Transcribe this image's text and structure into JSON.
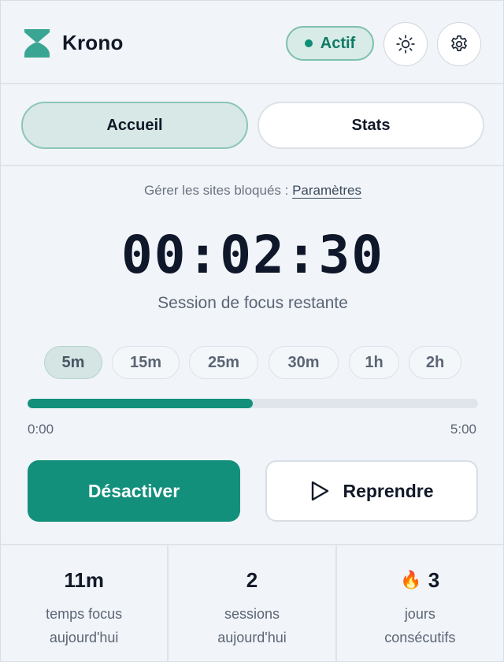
{
  "header": {
    "title": "Krono",
    "status": "Actif",
    "logo_icon": "hourglass-icon",
    "theme_icon": "sun-icon",
    "settings_icon": "gear-icon"
  },
  "tabs": [
    {
      "label": "Accueil",
      "active": true
    },
    {
      "label": "Stats",
      "active": false
    }
  ],
  "manage": {
    "text": "Gérer les sites bloqués : ",
    "link": "Paramètres"
  },
  "timer": {
    "value": "00:02:30",
    "label": "Session de focus restante"
  },
  "presets": [
    {
      "label": "5m",
      "active": true
    },
    {
      "label": "15m",
      "active": false
    },
    {
      "label": "25m",
      "active": false
    },
    {
      "label": "30m",
      "active": false
    },
    {
      "label": "1h",
      "active": false
    },
    {
      "label": "2h",
      "active": false
    }
  ],
  "progress": {
    "fraction": 0.5,
    "start": "0:00",
    "end": "5:00"
  },
  "actions": {
    "deactivate": "Désactiver",
    "resume": "Reprendre",
    "resume_icon": "play-icon"
  },
  "stats": [
    {
      "value": "11m",
      "label_line1": "temps focus",
      "label_line2": "aujourd'hui"
    },
    {
      "value": "2",
      "label_line1": "sessions",
      "label_line2": "aujourd'hui"
    },
    {
      "value": "3",
      "icon": "🔥",
      "label_line1": "jours",
      "label_line2": "consécutifs"
    }
  ],
  "colors": {
    "accent": "#12907c",
    "background": "#f1f4f8"
  }
}
